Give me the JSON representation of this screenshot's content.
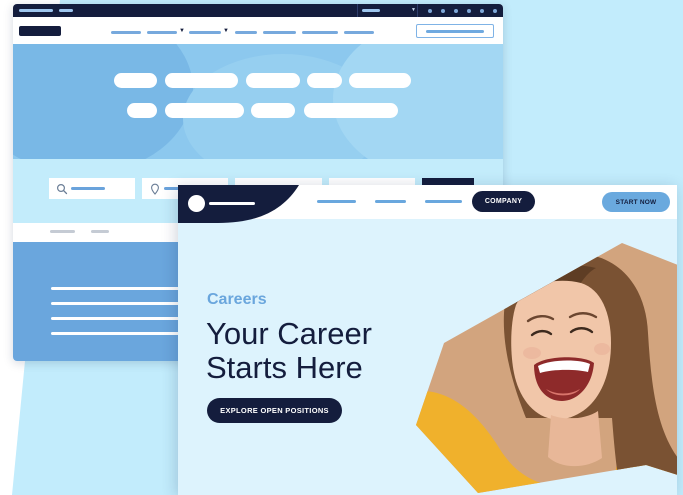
{
  "careers_page": {
    "nav": {
      "company_button": "COMPANY",
      "start_button": "START NOW"
    },
    "hero": {
      "eyebrow": "Careers",
      "headline": "Your Career Starts Here",
      "cta_button": "EXPLORE OPEN POSITIONS",
      "photo_alt": "Smiling woman with long hair in a yellow top"
    }
  },
  "search_fields": {
    "icons": [
      "search-icon",
      "location-pin-icon"
    ]
  },
  "colors": {
    "navy": "#141d3d",
    "accent_blue": "#6aa6dd",
    "light_blue": "#c3ecfb",
    "hero_blue": "#8cc8ee",
    "page_bg": "#ddf3fd",
    "tan": "#d2a47e"
  }
}
